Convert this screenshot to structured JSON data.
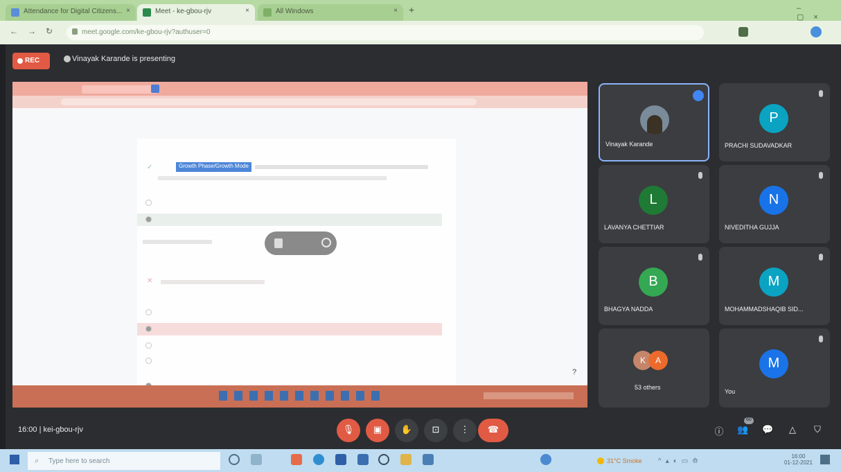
{
  "browser": {
    "tabs": [
      {
        "label": "Attendance for Digital Citizens..."
      },
      {
        "label": "Meet - ke-gbou-rjv"
      },
      {
        "label": "All Windows"
      }
    ],
    "url": "meet.google.com/ke-gbou-rjv?authuser=0"
  },
  "meet": {
    "rec_label": "REC",
    "presenting_text": "Vinayak Karande is presenting",
    "meeting_code": "16:00  |  kei-gbou-rjv"
  },
  "participants": [
    {
      "name": "Vinayak Karande",
      "avatar": "",
      "color": "#7a8c9a"
    },
    {
      "name": "PRACHI SUDAVADKAR",
      "avatar": "P",
      "color": "#0aa3c2"
    },
    {
      "name": "LAVANYA CHETTIAR",
      "avatar": "L",
      "color": "#1e7a34"
    },
    {
      "name": "NIVEDITHA GUJJA",
      "avatar": "N",
      "color": "#1973e8"
    },
    {
      "name": "BHAGYA NADDA",
      "avatar": "B",
      "color": "#34a853"
    },
    {
      "name": "MOHAMMADSHAQIB SID...",
      "avatar": "M",
      "color": "#0aa3c2"
    },
    {
      "name": "53 others",
      "avatar": "",
      "color": "#ec8a3c"
    },
    {
      "name": "You",
      "avatar": "M",
      "color": "#1a73e8"
    }
  ],
  "others_avatars": [
    "K",
    "A"
  ],
  "controls": {
    "mic": "mic-off",
    "cam": "cam-off",
    "hand": "raise-hand",
    "present": "present",
    "more": "more",
    "leave": "leave-call"
  },
  "right_icons": [
    "info",
    "people",
    "chat",
    "activities",
    "shield"
  ],
  "people_count": "60",
  "taskbar": {
    "search_placeholder": "Type here to search",
    "weather": "31°C  Smoke",
    "time": "16:00",
    "date": "01-12-2021"
  },
  "shared_form": {
    "highlight": "Growth Phase/Growth Mode"
  }
}
